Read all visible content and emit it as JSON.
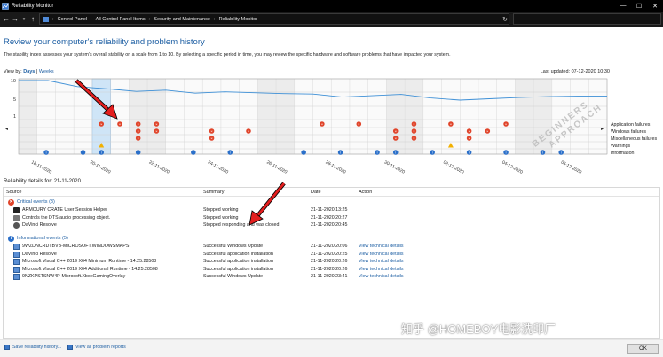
{
  "window": {
    "title": "Reliability Monitor",
    "minimize": "—",
    "maximize": "☐",
    "close": "✕"
  },
  "address": {
    "crumbs": [
      "Control Panel",
      "All Control Panel Items",
      "Security and Maintenance",
      "Reliability Monitor"
    ],
    "search_placeholder": ""
  },
  "page": {
    "heading": "Review your computer's reliability and problem history",
    "description": "The stability index assesses your system's overall stability on a scale from 1 to 10. By selecting a specific period in time, you may review the specific hardware and software problems that have impacted your system.",
    "view_by_label": "View by:",
    "view_days": "Days",
    "view_sep": "|",
    "view_weeks": "Weeks",
    "last_updated": "Last updated: 07-12-2020 10:30"
  },
  "chart_data": {
    "type": "line",
    "y_axis_labels": [
      "10",
      "5",
      "1"
    ],
    "ylim": [
      1,
      10
    ],
    "x_dates": [
      "19-11-2020",
      "20-11-2020",
      "21-11-2020",
      "22-11-2020",
      "23-11-2020",
      "24-11-2020",
      "25-11-2020",
      "26-11-2020",
      "27-11-2020",
      "28-11-2020",
      "29-11-2020",
      "30-11-2020",
      "01-12-2020",
      "02-12-2020",
      "03-12-2020",
      "04-12-2020",
      "05-12-2020",
      "06-12-2020",
      "07-12-2020"
    ],
    "x_tick_labels": [
      "18-11-2020",
      "20-11-2020",
      "22-11-2020",
      "24-11-2020",
      "26-11-2020",
      "28-11-2020",
      "30-11-2020",
      "02-12-2020",
      "04-12-2020",
      "06-12-2020"
    ],
    "selected_date": "21-11-2020",
    "stability_index": [
      10,
      10,
      8.6,
      8.1,
      7.5,
      7.8,
      7.1,
      7.4,
      7.2,
      7.0,
      6.9,
      6.2,
      6.5,
      6.8,
      6.0,
      5.5,
      5.8,
      6.1,
      6.3,
      6.4,
      6.4
    ],
    "row_labels": [
      "Application failures",
      "Windows failures",
      "Miscellaneous failures",
      "Warnings",
      "Information"
    ],
    "events": [
      {
        "column": 4,
        "row": 0
      },
      {
        "column": 5,
        "row": 0
      },
      {
        "column": 6,
        "row": 0
      },
      {
        "column": 7,
        "row": 0
      },
      {
        "column": 6,
        "row": 1
      },
      {
        "column": 7,
        "row": 1
      },
      {
        "column": 6,
        "row": 2
      },
      {
        "column": 10,
        "row": 1
      },
      {
        "column": 10,
        "row": 2
      },
      {
        "column": 12,
        "row": 1
      },
      {
        "column": 16,
        "row": 0
      },
      {
        "column": 18,
        "row": 0
      },
      {
        "column": 20,
        "row": 1
      },
      {
        "column": 20,
        "row": 2
      },
      {
        "column": 21,
        "row": 0
      },
      {
        "column": 21,
        "row": 1
      },
      {
        "column": 21,
        "row": 2
      },
      {
        "column": 23,
        "row": 0
      },
      {
        "column": 24,
        "row": 1
      },
      {
        "column": 24,
        "row": 2
      },
      {
        "column": 25,
        "row": 1
      },
      {
        "column": 26,
        "row": 0
      },
      {
        "column": 4,
        "row": 3
      },
      {
        "column": 23,
        "row": 3
      }
    ],
    "info_columns": [
      1,
      3,
      4,
      6,
      9,
      11,
      15,
      17,
      19,
      20,
      22,
      24,
      26,
      28,
      29
    ],
    "columns": 32
  },
  "details": {
    "label": "Reliability details for: 21-11-2020",
    "headers": {
      "source": "Source",
      "summary": "Summary",
      "date": "Date",
      "action": "Action"
    },
    "critical": {
      "title": "Critical events (3)",
      "rows": [
        {
          "source": "ARMOURY CRATE User Session Helper",
          "summary": "Stopped working",
          "date": "21-11-2020 13:25",
          "action": "",
          "icon": "armoury-icon"
        },
        {
          "source": "Controls the DTS audio processing object.",
          "summary": "Stopped working",
          "date": "21-11-2020 20:27",
          "action": "",
          "icon": "generic-app-icon"
        },
        {
          "source": "DaVinci Resolve",
          "summary": "Stopped responding and was closed",
          "date": "21-11-2020 20:45",
          "action": "",
          "icon": "davinci-icon"
        }
      ]
    },
    "informational": {
      "title": "Informational events (5)",
      "rows": [
        {
          "source": "9WZDNCRDTBVB-MICROSOFT.WINDOWSMAPS",
          "summary": "Successful Windows Update",
          "date": "21-11-2020 20:06",
          "action": "View technical details"
        },
        {
          "source": "DaVinci Resolve",
          "summary": "Successful application installation",
          "date": "21-11-2020 20:25",
          "action": "View technical details"
        },
        {
          "source": "Microsoft Visual C++ 2019 X64 Minimum Runtime - 14.25.28508",
          "summary": "Successful application installation",
          "date": "21-11-2020 20:26",
          "action": "View technical details"
        },
        {
          "source": "Microsoft Visual C++ 2019 X64 Additional Runtime - 14.25.28508",
          "summary": "Successful application installation",
          "date": "21-11-2020 20:26",
          "action": "View technical details"
        },
        {
          "source": "9NZKPSTSNW4P-Microsoft.XboxGamingOverlay",
          "summary": "Successful Windows Update",
          "date": "21-11-2020 23:41",
          "action": "View technical details"
        }
      ]
    }
  },
  "footer": {
    "save": "Save reliability history...",
    "view_all": "View all problem reports",
    "ok": "OK"
  },
  "watermarks": {
    "bottom": "知乎 @HOMEBOY电影洗印厂",
    "diagonal_1": "BEGINNERS",
    "diagonal_2": "APPROACH"
  },
  "colors": {
    "accent": "#1e5fa3",
    "error": "#e0442a",
    "info": "#2a6fc9",
    "warning": "#f2b000",
    "selection": "#cfe5f7",
    "annotation_arrow": "#e31e1e"
  }
}
